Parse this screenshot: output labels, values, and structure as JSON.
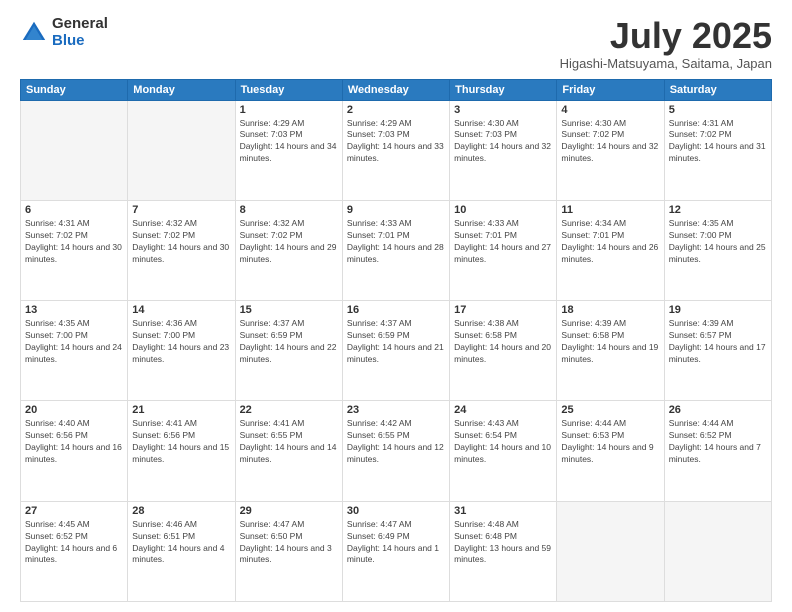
{
  "header": {
    "logo_general": "General",
    "logo_blue": "Blue",
    "month_title": "July 2025",
    "location": "Higashi-Matsuyama, Saitama, Japan"
  },
  "days_of_week": [
    "Sunday",
    "Monday",
    "Tuesday",
    "Wednesday",
    "Thursday",
    "Friday",
    "Saturday"
  ],
  "weeks": [
    [
      {
        "day": "",
        "empty": true
      },
      {
        "day": "",
        "empty": true
      },
      {
        "day": "1",
        "sunrise": "4:29 AM",
        "sunset": "7:03 PM",
        "daylight": "14 hours and 34 minutes."
      },
      {
        "day": "2",
        "sunrise": "4:29 AM",
        "sunset": "7:03 PM",
        "daylight": "14 hours and 33 minutes."
      },
      {
        "day": "3",
        "sunrise": "4:30 AM",
        "sunset": "7:03 PM",
        "daylight": "14 hours and 32 minutes."
      },
      {
        "day": "4",
        "sunrise": "4:30 AM",
        "sunset": "7:02 PM",
        "daylight": "14 hours and 32 minutes."
      },
      {
        "day": "5",
        "sunrise": "4:31 AM",
        "sunset": "7:02 PM",
        "daylight": "14 hours and 31 minutes."
      }
    ],
    [
      {
        "day": "6",
        "sunrise": "4:31 AM",
        "sunset": "7:02 PM",
        "daylight": "14 hours and 30 minutes."
      },
      {
        "day": "7",
        "sunrise": "4:32 AM",
        "sunset": "7:02 PM",
        "daylight": "14 hours and 30 minutes."
      },
      {
        "day": "8",
        "sunrise": "4:32 AM",
        "sunset": "7:02 PM",
        "daylight": "14 hours and 29 minutes."
      },
      {
        "day": "9",
        "sunrise": "4:33 AM",
        "sunset": "7:01 PM",
        "daylight": "14 hours and 28 minutes."
      },
      {
        "day": "10",
        "sunrise": "4:33 AM",
        "sunset": "7:01 PM",
        "daylight": "14 hours and 27 minutes."
      },
      {
        "day": "11",
        "sunrise": "4:34 AM",
        "sunset": "7:01 PM",
        "daylight": "14 hours and 26 minutes."
      },
      {
        "day": "12",
        "sunrise": "4:35 AM",
        "sunset": "7:00 PM",
        "daylight": "14 hours and 25 minutes."
      }
    ],
    [
      {
        "day": "13",
        "sunrise": "4:35 AM",
        "sunset": "7:00 PM",
        "daylight": "14 hours and 24 minutes."
      },
      {
        "day": "14",
        "sunrise": "4:36 AM",
        "sunset": "7:00 PM",
        "daylight": "14 hours and 23 minutes."
      },
      {
        "day": "15",
        "sunrise": "4:37 AM",
        "sunset": "6:59 PM",
        "daylight": "14 hours and 22 minutes."
      },
      {
        "day": "16",
        "sunrise": "4:37 AM",
        "sunset": "6:59 PM",
        "daylight": "14 hours and 21 minutes."
      },
      {
        "day": "17",
        "sunrise": "4:38 AM",
        "sunset": "6:58 PM",
        "daylight": "14 hours and 20 minutes."
      },
      {
        "day": "18",
        "sunrise": "4:39 AM",
        "sunset": "6:58 PM",
        "daylight": "14 hours and 19 minutes."
      },
      {
        "day": "19",
        "sunrise": "4:39 AM",
        "sunset": "6:57 PM",
        "daylight": "14 hours and 17 minutes."
      }
    ],
    [
      {
        "day": "20",
        "sunrise": "4:40 AM",
        "sunset": "6:56 PM",
        "daylight": "14 hours and 16 minutes."
      },
      {
        "day": "21",
        "sunrise": "4:41 AM",
        "sunset": "6:56 PM",
        "daylight": "14 hours and 15 minutes."
      },
      {
        "day": "22",
        "sunrise": "4:41 AM",
        "sunset": "6:55 PM",
        "daylight": "14 hours and 14 minutes."
      },
      {
        "day": "23",
        "sunrise": "4:42 AM",
        "sunset": "6:55 PM",
        "daylight": "14 hours and 12 minutes."
      },
      {
        "day": "24",
        "sunrise": "4:43 AM",
        "sunset": "6:54 PM",
        "daylight": "14 hours and 10 minutes."
      },
      {
        "day": "25",
        "sunrise": "4:44 AM",
        "sunset": "6:53 PM",
        "daylight": "14 hours and 9 minutes."
      },
      {
        "day": "26",
        "sunrise": "4:44 AM",
        "sunset": "6:52 PM",
        "daylight": "14 hours and 7 minutes."
      }
    ],
    [
      {
        "day": "27",
        "sunrise": "4:45 AM",
        "sunset": "6:52 PM",
        "daylight": "14 hours and 6 minutes."
      },
      {
        "day": "28",
        "sunrise": "4:46 AM",
        "sunset": "6:51 PM",
        "daylight": "14 hours and 4 minutes."
      },
      {
        "day": "29",
        "sunrise": "4:47 AM",
        "sunset": "6:50 PM",
        "daylight": "14 hours and 3 minutes."
      },
      {
        "day": "30",
        "sunrise": "4:47 AM",
        "sunset": "6:49 PM",
        "daylight": "14 hours and 1 minute."
      },
      {
        "day": "31",
        "sunrise": "4:48 AM",
        "sunset": "6:48 PM",
        "daylight": "13 hours and 59 minutes."
      },
      {
        "day": "",
        "empty": true
      },
      {
        "day": "",
        "empty": true
      }
    ]
  ]
}
